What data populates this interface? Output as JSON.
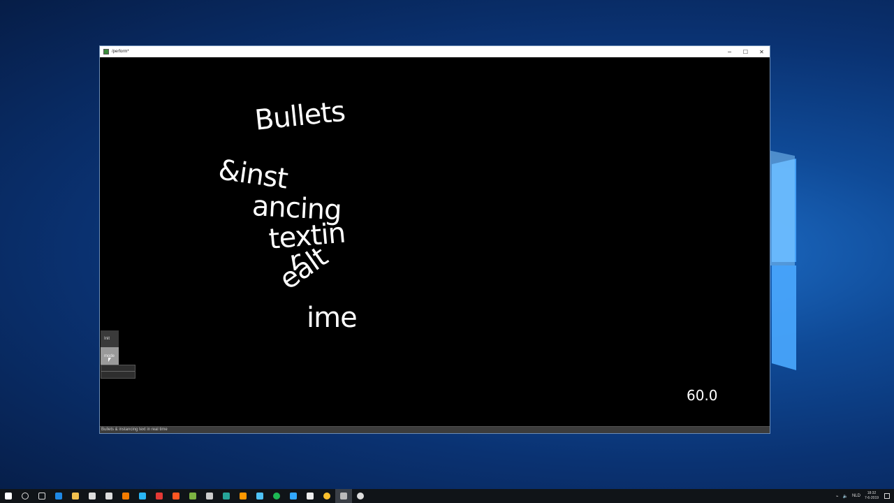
{
  "window": {
    "title": "/perform*",
    "minimize": "─",
    "maximize": "☐",
    "close": "✕"
  },
  "canvas": {
    "words": [
      "Bullets",
      "&inst",
      "ancing",
      "textin",
      "r",
      "ealt",
      "ime"
    ],
    "fps": "60.0"
  },
  "gui": {
    "init_label": "Init",
    "mode_label": "mode"
  },
  "status_bar": {
    "text": "Bullets & instancing text in real time"
  },
  "taskbar": {
    "apps": [
      {
        "icon": "windows-start-icon",
        "color": "#ffffff"
      },
      {
        "icon": "search-icon",
        "color": "#dddddd"
      },
      {
        "icon": "task-view-icon",
        "color": "#dddddd"
      },
      {
        "icon": "edge-icon",
        "color": "#1e88e5"
      },
      {
        "icon": "file-explorer-icon",
        "color": "#f2c14e"
      },
      {
        "icon": "store-icon",
        "color": "#dddddd"
      },
      {
        "icon": "mail-icon",
        "color": "#dddddd"
      },
      {
        "icon": "blender-icon",
        "color": "#f57c00"
      },
      {
        "icon": "app-triangle-icon",
        "color": "#29b6f6"
      },
      {
        "icon": "app-red-icon",
        "color": "#e53935"
      },
      {
        "icon": "app-orange-icon",
        "color": "#ff5722"
      },
      {
        "icon": "app-gradient-icon",
        "color": "#7cb342"
      },
      {
        "icon": "app-gun-icon",
        "color": "#cccccc"
      },
      {
        "icon": "app-lr-icon",
        "color": "#26a69a"
      },
      {
        "icon": "sublime-icon",
        "color": "#ff9800"
      },
      {
        "icon": "app-lr2-icon",
        "color": "#4fc3f7"
      },
      {
        "icon": "spotify-icon",
        "color": "#1db954"
      },
      {
        "icon": "photoshop-icon",
        "color": "#31a8ff"
      },
      {
        "icon": "notepad-icon",
        "color": "#eeeeee"
      },
      {
        "icon": "chrome-icon",
        "color": "#fbc02d"
      },
      {
        "icon": "app-active-icon",
        "color": "#bbbbbb"
      },
      {
        "icon": "unity-icon",
        "color": "#dddddd"
      }
    ],
    "tray": {
      "language": "NLD",
      "time": "18:32",
      "date": "7-6-2019"
    }
  }
}
